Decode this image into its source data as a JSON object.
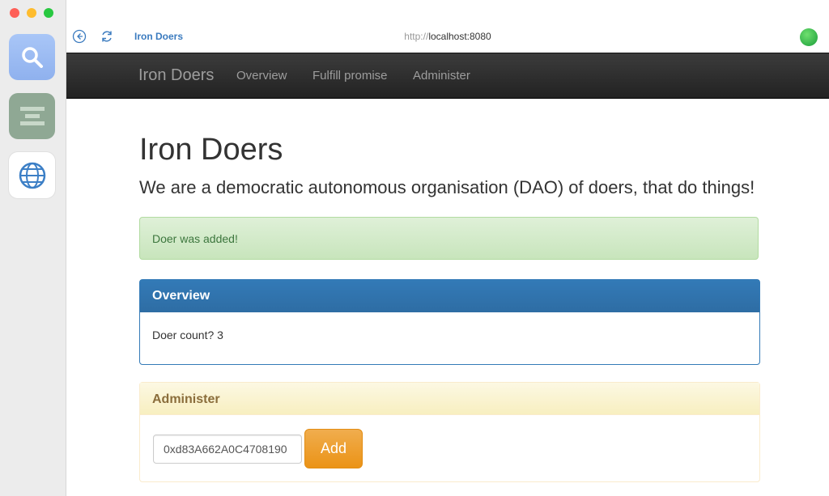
{
  "window": {
    "tab_title": "Iron Doers",
    "url_scheme": "http://",
    "url_host": "localhost:8080"
  },
  "dock": {
    "apps": [
      {
        "name": "search-app",
        "icon": "magnifier-icon"
      },
      {
        "name": "notes-app",
        "icon": "list-icon"
      },
      {
        "name": "browser-app",
        "icon": "globe-icon"
      }
    ]
  },
  "navbar": {
    "brand": "Iron Doers",
    "links": [
      "Overview",
      "Fulfill promise",
      "Administer"
    ]
  },
  "page": {
    "title": "Iron Doers",
    "lead": "We are a democratic autonomous organisation (DAO) of doers, that do things!"
  },
  "alert": {
    "text": "Doer was added!"
  },
  "overview_panel": {
    "heading": "Overview",
    "label": "Doer count?",
    "count": "3"
  },
  "administer_panel": {
    "heading": "Administer",
    "address_value": "0xd83A662A0C4708190",
    "add_label": "Add"
  },
  "colors": {
    "navbar": "#222222",
    "primary": "#337ab7",
    "success_bg": "#dff0d8",
    "warning_bg": "#fcf8e3",
    "button_orange": "#f0ad4e"
  }
}
